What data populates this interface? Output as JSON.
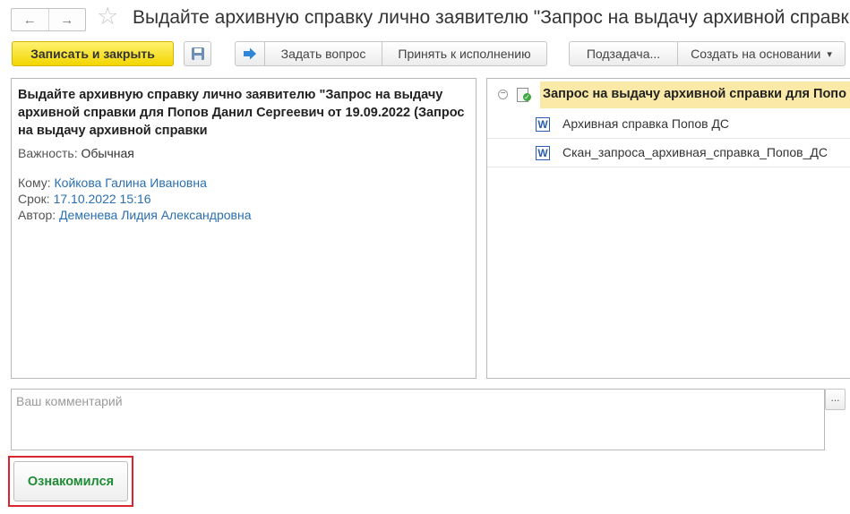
{
  "window": {
    "title": "Выдайте архивную справку лично заявителю \"Запрос на выдачу архивной справки"
  },
  "nav": {
    "back_icon": "←",
    "forward_icon": "→",
    "favorite_icon": "☆"
  },
  "toolbar": {
    "save_close_label": "Записать и закрыть",
    "ask_question_label": "Задать вопрос",
    "accept_label": "Принять к исполнению",
    "subtask_label": "Подзадача...",
    "create_based_label": "Создать на основании",
    "dropdown_arrow": "▾"
  },
  "task": {
    "subject": "Выдайте архивную справку лично заявителю \"Запрос на выдачу архивной справки для Попов Данил Сергеевич от 19.09.2022 (Запрос на выдачу архивной справки",
    "importance_label": "Важность:",
    "importance_value": "Обычная",
    "to_label": "Кому:",
    "to_value": "Койкова Галина Ивановна",
    "due_label": "Срок:",
    "due_value": "17.10.2022 15:16",
    "author_label": "Автор:",
    "author_value": "Деменева Лидия Александровна"
  },
  "attachments": {
    "root_label": "Запрос на выдачу архивной справки для Попо",
    "collapse_glyph": "−",
    "items": [
      {
        "label": "Архивная справка Попов ДС",
        "icon": "W"
      },
      {
        "label": "Скан_запроса_архивная_справка_Попов_ДС",
        "icon": "W"
      }
    ]
  },
  "comment": {
    "placeholder": "Ваш комментарий",
    "more_label": "..."
  },
  "actions": {
    "acknowledge_label": "Ознакомился"
  },
  "colors": {
    "primary_button": "#f2d500",
    "link": "#2a6fb0",
    "acknowledge_text": "#1e8c34",
    "highlight_frame": "#d9262e",
    "tree_selection": "#fbeaa7"
  }
}
